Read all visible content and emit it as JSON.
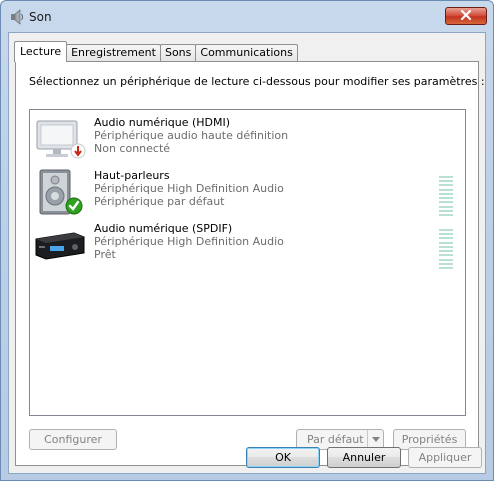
{
  "window": {
    "title": "Son",
    "icon": "speaker-icon",
    "close_icon": "close-icon"
  },
  "tabs": [
    {
      "label": "Lecture",
      "active": true
    },
    {
      "label": "Enregistrement",
      "active": false
    },
    {
      "label": "Sons",
      "active": false
    },
    {
      "label": "Communications",
      "active": false
    }
  ],
  "instruction": "Sélectionnez un périphérique de lecture ci-dessous pour modifier ses paramètres :",
  "devices": [
    {
      "name": "Audio numérique (HDMI)",
      "type": "Périphérique audio haute définition",
      "status": "Non connecté",
      "icon": "monitor-icon",
      "badge": "disconnected-badge-icon",
      "meter": false
    },
    {
      "name": "Haut-parleurs",
      "type": "Périphérique High Definition Audio",
      "status": "Périphérique par défaut",
      "icon": "speaker-icon",
      "badge": "default-check-icon",
      "meter": true
    },
    {
      "name": "Audio numérique (SPDIF)",
      "type": "Périphérique High Definition Audio",
      "status": "Prêt",
      "icon": "receiver-icon",
      "badge": "",
      "meter": true
    }
  ],
  "panel_buttons": {
    "configure": "Configurer",
    "set_default": "Par défaut",
    "properties": "Propriétés"
  },
  "dialog_buttons": {
    "ok": "OK",
    "cancel": "Annuler",
    "apply": "Appliquer"
  },
  "colors": {
    "accent": "#3c7fb1",
    "close": "#c13320",
    "check": "#2fa31f",
    "meter": "#b9e0d6"
  }
}
